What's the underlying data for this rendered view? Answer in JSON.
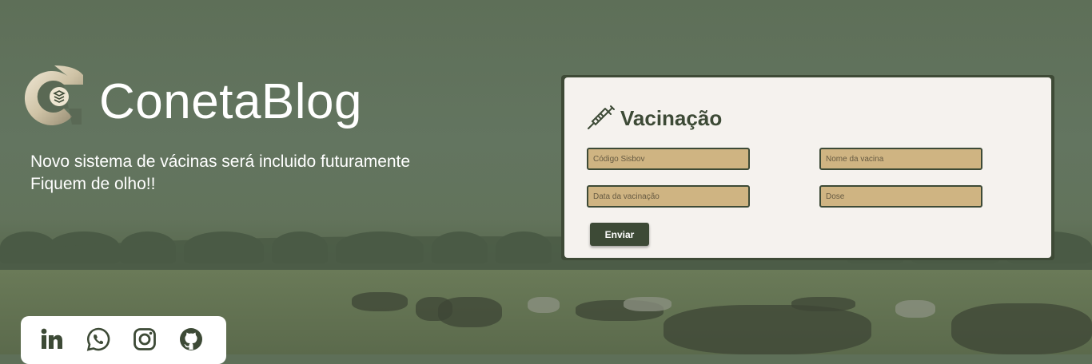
{
  "brand": {
    "name": "ConetaBlog",
    "tagline_line1": "Novo sistema de vácinas será incluido futuramente",
    "tagline_line2": "Fiquem de olho!!"
  },
  "form": {
    "title": "Vacinação",
    "fields": [
      {
        "placeholder": "Código Sisbov",
        "value": ""
      },
      {
        "placeholder": "Nome da vacina",
        "value": ""
      },
      {
        "placeholder": "Data da vacinação",
        "value": ""
      },
      {
        "placeholder": "Dose",
        "value": ""
      }
    ],
    "submit_label": "Enviar"
  },
  "social": [
    {
      "icon": "linkedin-icon"
    },
    {
      "icon": "whatsapp-icon"
    },
    {
      "icon": "instagram-icon"
    },
    {
      "icon": "github-icon"
    }
  ],
  "colors": {
    "primary": "#3d4a36",
    "input_bg": "#cfb482",
    "card_bg": "#f5f2ee"
  }
}
